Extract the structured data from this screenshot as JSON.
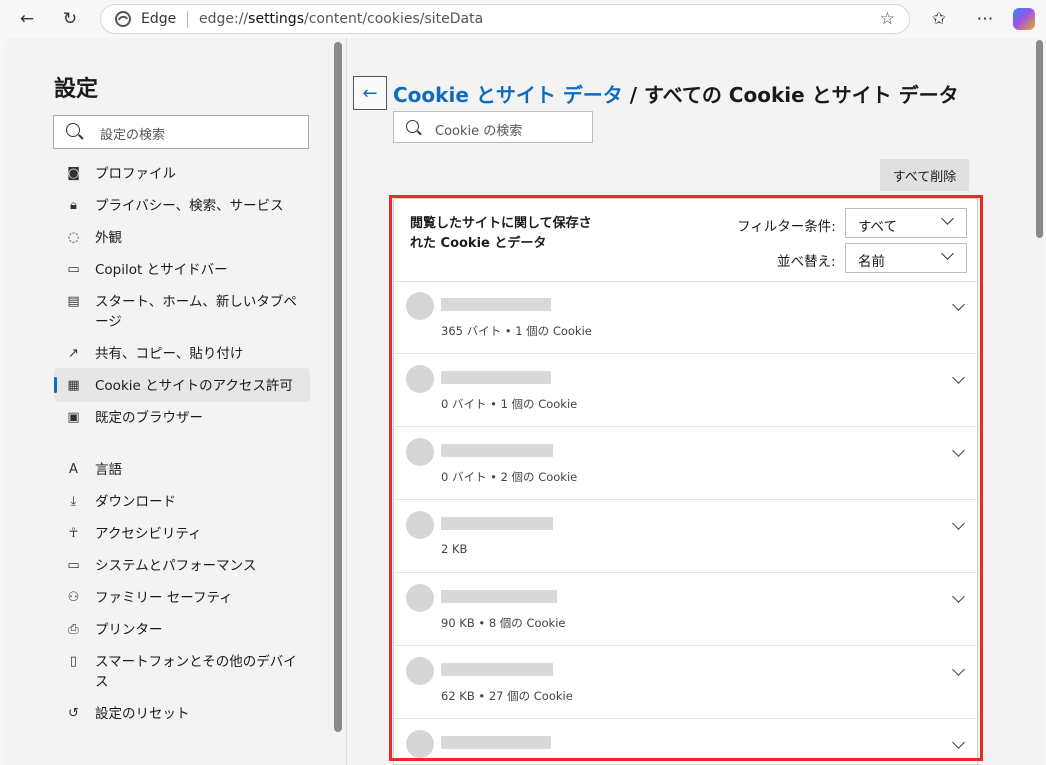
{
  "browser": {
    "site_name": "Edge",
    "url_scheme": "edge://",
    "url_host": "settings",
    "url_path": "/content/cookies/siteData"
  },
  "sidebar": {
    "title": "設定",
    "search_placeholder": "設定の検索",
    "items": [
      {
        "label": "プロファイル",
        "icon": "profile-icon"
      },
      {
        "label": "プライバシー、検索、サービス",
        "icon": "lock-icon"
      },
      {
        "label": "外観",
        "icon": "palette-icon"
      },
      {
        "label": "Copilot とサイドバー",
        "icon": "sidebar-icon"
      },
      {
        "label": "スタート、ホーム、新しいタブページ",
        "icon": "home-icon"
      },
      {
        "label": "共有、コピー、貼り付け",
        "icon": "share-icon"
      },
      {
        "label": "Cookie とサイトのアクセス許可",
        "icon": "cookie-permissions-icon"
      },
      {
        "label": "既定のブラウザー",
        "icon": "default-browser-icon"
      },
      {
        "label": "言語",
        "icon": "language-icon"
      },
      {
        "label": "ダウンロード",
        "icon": "download-icon"
      },
      {
        "label": "アクセシビリティ",
        "icon": "accessibility-icon"
      },
      {
        "label": "システムとパフォーマンス",
        "icon": "laptop-icon"
      },
      {
        "label": "ファミリー セーフティ",
        "icon": "family-icon"
      },
      {
        "label": "プリンター",
        "icon": "printer-icon"
      },
      {
        "label": "スマートフォンとその他のデバイス",
        "icon": "phone-icon"
      },
      {
        "label": "設定のリセット",
        "icon": "reset-icon"
      }
    ]
  },
  "main": {
    "breadcrumb_link": "Cookie とサイト データ",
    "breadcrumb_current": " / すべての Cookie とサイト データ",
    "search_placeholder": "Cookie の検索",
    "delete_all_label": "すべて削除",
    "list_header": "閲覧したサイトに関して保存された Cookie とデータ",
    "filter_label": "フィルター条件:",
    "filter_value": "すべて",
    "sort_label": "並べ替え:",
    "sort_value": "名前",
    "sites": [
      {
        "info": "365 バイト • 1 個の Cookie"
      },
      {
        "info": "0 バイト • 1 個の Cookie"
      },
      {
        "info": "0 バイト • 2 個の Cookie"
      },
      {
        "info": "2 KB"
      },
      {
        "info": "90 KB • 8 個の Cookie"
      },
      {
        "info": "62 KB • 27 個の Cookie"
      },
      {
        "info": ""
      }
    ]
  },
  "colors": {
    "accent": "#0f6cbd",
    "highlight": "#ee2a24"
  }
}
